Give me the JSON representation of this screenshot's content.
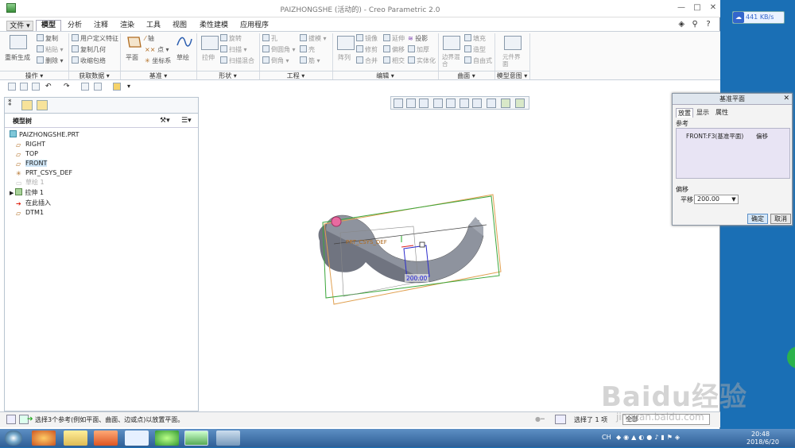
{
  "window": {
    "title": "PAIZHONGSHE (活动的) - Creo Parametric 2.0",
    "controls": [
      "—",
      "□",
      "✕"
    ]
  },
  "tabs": [
    "文件 ▾",
    "模型",
    "分析",
    "注释",
    "渲染",
    "工具",
    "视图",
    "柔性建模",
    "应用程序"
  ],
  "active_tab": "模型",
  "ribbon": {
    "ops": [
      "重新生成",
      "复制",
      "粘贴 ▾",
      "删除 ▾"
    ],
    "getdata": [
      "用户定义特征",
      "复制几何",
      "收缩包络"
    ],
    "datum": [
      "平面",
      "轴",
      "点 ▾",
      "坐标系",
      "草绘"
    ],
    "shapes": [
      "拉伸",
      "旋转",
      "扫描 ▾",
      "扫描混合"
    ],
    "eng": [
      "孔",
      "倒圆角 ▾",
      "倒角 ▾",
      "拔模 ▾",
      "壳",
      "筋 ▾"
    ],
    "edit": [
      "阵列",
      "镜像",
      "修剪",
      "合并",
      "延伸",
      "偏移",
      "相交",
      "投影",
      "加厚",
      "实体化"
    ],
    "surface": [
      "边界混合",
      "填充",
      "造型",
      "自由式"
    ],
    "model_intent": [
      "元件界面"
    ],
    "groups": [
      "操作 ▾",
      "获取数据 ▾",
      "基准 ▾",
      "形状 ▾",
      "工程 ▾",
      "编辑 ▾",
      "曲面 ▾",
      "模型意图 ▾"
    ]
  },
  "tree": {
    "header": "模型树",
    "items": [
      {
        "label": "PAIZHONGSHE.PRT",
        "icon": "part-icon"
      },
      {
        "label": "RIGHT",
        "icon": "datum-plane-icon"
      },
      {
        "label": "TOP",
        "icon": "datum-plane-icon"
      },
      {
        "label": "FRONT",
        "icon": "datum-plane-icon"
      },
      {
        "label": "PRT_CSYS_DEF",
        "icon": "csys-icon"
      },
      {
        "label": "草绘 1",
        "icon": "sketch-icon"
      },
      {
        "label": "拉伸 1",
        "icon": "extrude-icon"
      },
      {
        "label": "在此插入",
        "icon": "insert-arrow-icon"
      },
      {
        "label": "DTM1",
        "icon": "datum-plane-icon"
      }
    ]
  },
  "viewport": {
    "csys_label": "PRT_CSYS_DEF",
    "dimension": "200.00"
  },
  "dialog": {
    "title": "基准平面",
    "tabs": [
      "放置",
      "显示",
      "属性"
    ],
    "ref_label": "参考",
    "ref_name": "FRONT:F3(基准平面)",
    "ref_type": "偏移",
    "offset_label": "偏移",
    "translate_label": "平移",
    "translate_value": "200.00",
    "ok": "确定",
    "cancel": "取消"
  },
  "status": {
    "message": "选择3个参考(例如平面、曲面、边或点)以放置平面。",
    "selected": "选择了 1 项",
    "filter": "全部"
  },
  "netspeed": "441 KB/s",
  "taskbar": {
    "lang": "CH",
    "time": "20:48",
    "date": "2018/6/20"
  },
  "watermark": {
    "text": "Baidu经验",
    "url": "jingyan.baidu.com"
  }
}
